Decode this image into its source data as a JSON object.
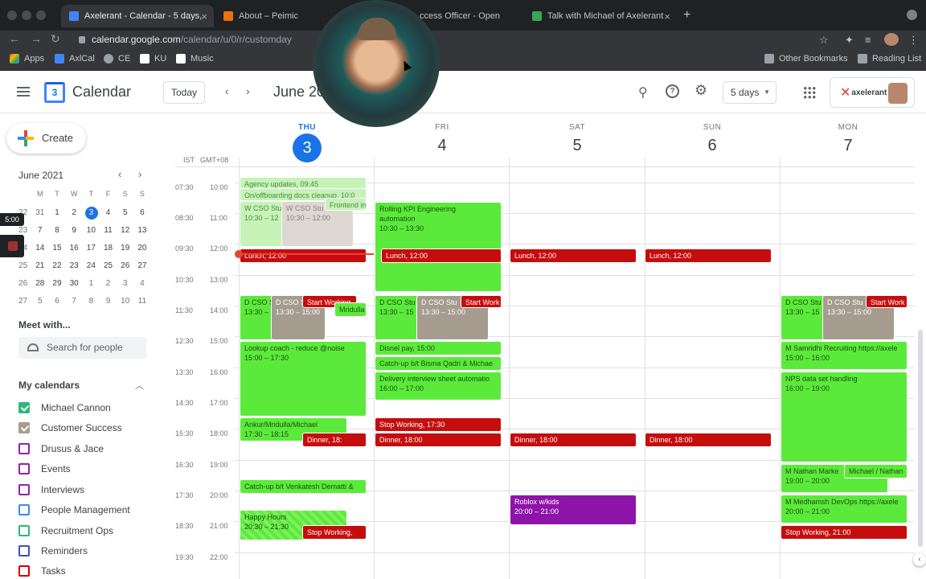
{
  "browser": {
    "tabs": [
      {
        "title": "Axelerant - Calendar - 5 days,",
        "color": "#4285f4",
        "active": true
      },
      {
        "title": "About – Peimic",
        "color": "#e8710a",
        "active": false
      },
      {
        "title": "ccess Officer - Open",
        "color": "#5f6368",
        "active": false
      },
      {
        "title": "Talk with Michael of Axelerant",
        "color": "#34a853",
        "active": false
      }
    ],
    "url_host": "calendar.google.com",
    "url_path": "/calendar/u/0/r/customday",
    "bookmarks": [
      "Apps",
      "AxlCal",
      "CE",
      "KU",
      "Music"
    ],
    "bookmarks_right": [
      "Other Bookmarks",
      "Reading List"
    ]
  },
  "header": {
    "app_title": "Calendar",
    "logo_text": "3",
    "today_label": "Today",
    "month_label": "June 20",
    "view_label": "5 days",
    "brand_name": "axelerant"
  },
  "sidebar": {
    "create_label": "Create",
    "mini_title": "June 2021",
    "weekday_heads": [
      "M",
      "T",
      "W",
      "T",
      "F",
      "S",
      "S"
    ],
    "weeks": [
      [
        "31",
        "1",
        "2",
        "3",
        "4",
        "5",
        "6"
      ],
      [
        "7",
        "8",
        "9",
        "10",
        "11",
        "12",
        "13"
      ],
      [
        "14",
        "15",
        "16",
        "17",
        "18",
        "19",
        "20"
      ],
      [
        "21",
        "22",
        "23",
        "24",
        "25",
        "26",
        "27"
      ],
      [
        "28",
        "29",
        "30",
        "1",
        "2",
        "3",
        "4"
      ],
      [
        "5",
        "6",
        "7",
        "8",
        "9",
        "10",
        "11"
      ]
    ],
    "week_nums": [
      "22",
      "23",
      "24",
      "25",
      "26",
      "27"
    ],
    "badge": "5:00",
    "meet_title": "Meet with...",
    "search_placeholder": "Search for people",
    "my_calendars_title": "My calendars",
    "calendars": [
      {
        "name": "Michael Cannon",
        "color": "#33b679",
        "checked": true
      },
      {
        "name": "Customer Success",
        "color": "#a79b8e",
        "checked": true
      },
      {
        "name": "Drusus & Jace",
        "color": "#8e24aa",
        "checked": false
      },
      {
        "name": "Events",
        "color": "#8e24aa",
        "checked": false
      },
      {
        "name": "Interviews",
        "color": "#8e24aa",
        "checked": false
      },
      {
        "name": "People Management",
        "color": "#4285f4",
        "checked": false
      },
      {
        "name": "Recruitment Ops",
        "color": "#33b679",
        "checked": false
      },
      {
        "name": "Reminders",
        "color": "#3f51b5",
        "checked": false
      },
      {
        "name": "Tasks",
        "color": "#d50000",
        "checked": false
      }
    ]
  },
  "grid": {
    "tz_left": "IST",
    "tz_right": "GMT+08",
    "days": [
      {
        "name": "THU",
        "num": "3",
        "today": true
      },
      {
        "name": "FRI",
        "num": "4",
        "today": false
      },
      {
        "name": "SAT",
        "num": "5",
        "today": false
      },
      {
        "name": "SUN",
        "num": "6",
        "today": false
      },
      {
        "name": "MON",
        "num": "7",
        "today": false
      }
    ],
    "times_ist": [
      "07:30",
      "08:30",
      "09:30",
      "10:30",
      "11:30",
      "12:30",
      "13:30",
      "14:30",
      "15:30",
      "16:30",
      "17:30",
      "18:30",
      "19:30"
    ],
    "times_local": [
      "10:00",
      "11:00",
      "12:00",
      "13:00",
      "14:00",
      "15:00",
      "16:00",
      "17:00",
      "18:00",
      "19:00",
      "20:00",
      "21:00",
      "22:00"
    ]
  },
  "events": {
    "agency": "Agency updates, 09:45",
    "onboarding": "On/offboarding docs cleanup, 10:0",
    "frontend": "Frontend in",
    "wcso1": "W CSO Stu",
    "wcso1_time": "10:30 – 12",
    "wcso2": "W CSO Stu",
    "wcso2_time": "10:30 – 12:00",
    "lunch": "Lunch, 12:00",
    "dcso1": "D CSO S",
    "dcso1_time": "13:30 –",
    "dcso2": "D CSO S",
    "dcso2_time": "13:30 – 15:00",
    "start_working": "Start Working",
    "mridulla": "Mridulla",
    "lookup": "Lookup coach - reduce @noise",
    "lookup_time": "15:00 – 17:30",
    "ankur": "Ankur/Mridulla/Michael",
    "ankur_time": "17:30 – 18:15",
    "dinner_short": "Dinner, 18:",
    "catchup_v": "Catch-up b/t Venkatesh Dematti &",
    "happy": "Happy Hours",
    "happy_time": "20:30 – 21:30",
    "stop_working_thu": "Stop Working,",
    "rolling": "Rolling KPI Engineering",
    "rolling2": "automation",
    "rolling_time": "10:30 – 13:30",
    "fri_dcso1": "D CSO Stu",
    "fri_dcso1_time": "13:30 – 15",
    "fri_dcso2": "D CSO Stu",
    "fri_dcso2_time": "13:30 – 15:00",
    "fri_start": "Start Work",
    "disnel": "Disnel pay, 15:00",
    "catchup_b": "Catch-up b/t Bisma Qadri & Michae",
    "delivery": "Delivery interview sheet automatio",
    "delivery_time": "16:00 – 17:00",
    "stop_working_fri": "Stop Working, 17:30",
    "dinner": "Dinner, 18:00",
    "roblox": "Roblox w/kids",
    "roblox_time": "20:00 – 21:00",
    "mon_dcso1": "D CSO Stu",
    "mon_dcso1_time": "13:30 – 15",
    "mon_dcso2": "D CSO Stu",
    "mon_dcso2_time": "13:30 – 15:00",
    "mon_start": "Start Work",
    "samridhi": "M Samridhi Recruiting https://axele",
    "samridhi_time": "15:00 – 16:00",
    "nps": "NPS data set handling",
    "nps_time": "16:00 – 19:00",
    "nathan": "M Nathan Marke",
    "nathan_time": "19:00 – 20:00",
    "michael_nathan": "Michael / Nathan",
    "medhamsh": "M Medhamsh DevOps https://axele",
    "medhamsh_time": "20:00 – 21:00",
    "stop_working_mon": "Stop Working, 21:00"
  }
}
